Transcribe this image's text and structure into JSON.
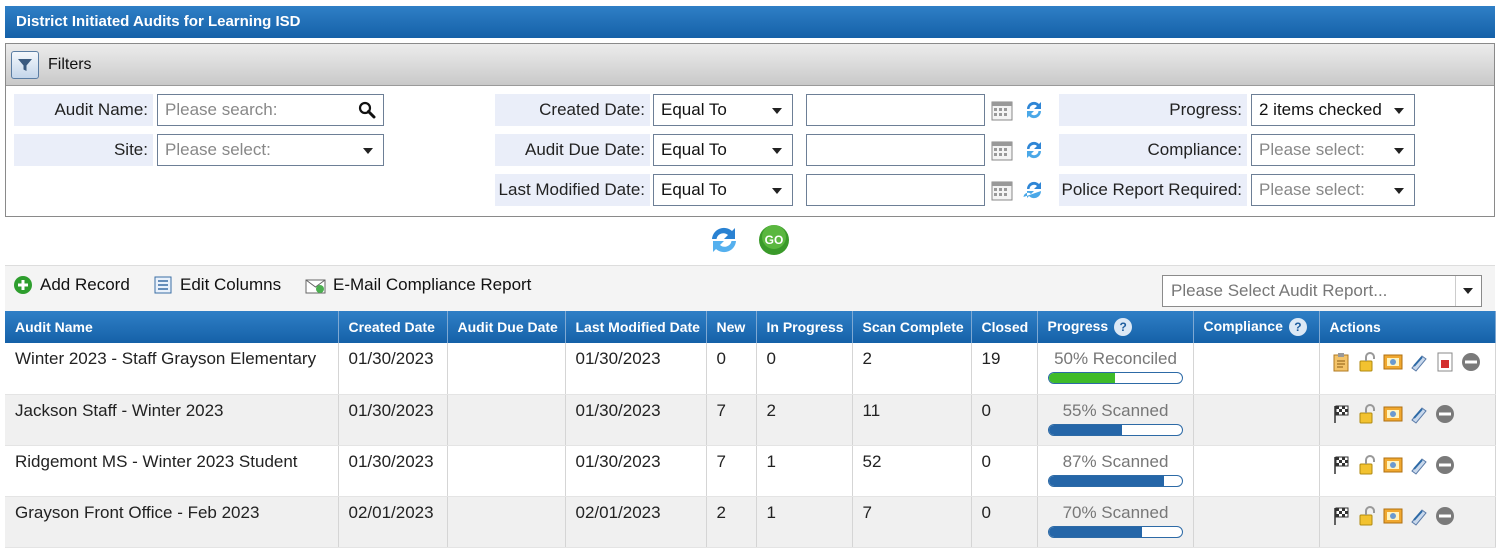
{
  "title": "District Initiated Audits for Learning ISD",
  "filters": {
    "header_label": "Filters",
    "audit_name": {
      "label": "Audit Name:",
      "placeholder": "Please search:"
    },
    "site": {
      "label": "Site:",
      "placeholder": "Please select:"
    },
    "created_date": {
      "label": "Created Date:",
      "operator": "Equal To",
      "value": ""
    },
    "audit_due_date": {
      "label": "Audit Due Date:",
      "operator": "Equal To",
      "value": ""
    },
    "last_modified_date": {
      "label": "Last Modified Date:",
      "operator": "Equal To",
      "value": ""
    },
    "progress": {
      "label": "Progress:",
      "value": "2 items checked"
    },
    "compliance": {
      "label": "Compliance:",
      "placeholder": "Please select:"
    },
    "police_report": {
      "label": "Police Report Required:",
      "placeholder": "Please select:"
    }
  },
  "toolbar": {
    "add_record": "Add Record",
    "edit_columns": "Edit Columns",
    "email_report": "E-Mail Compliance Report",
    "audit_report_placeholder": "Please Select Audit Report..."
  },
  "columns": [
    "Audit Name",
    "Created Date",
    "Audit Due Date",
    "Last Modified Date",
    "New",
    "In Progress",
    "Scan Complete",
    "Closed",
    "Progress",
    "Compliance",
    "Actions"
  ],
  "rows": [
    {
      "name": "Winter 2023 - Staff Grayson Elementary",
      "created": "01/30/2023",
      "due": "",
      "modified": "01/30/2023",
      "new": "0",
      "in_progress": "0",
      "scan_complete": "2",
      "closed": "19",
      "progress_label": "50% Reconciled",
      "progress_pct": 50,
      "progress_color": "#3fbb2a",
      "compliance": "",
      "actions": [
        "clipboard-icon",
        "unlock-icon",
        "photo-icon",
        "scanner-icon",
        "pdf-report-icon",
        "remove-icon"
      ]
    },
    {
      "name": "Jackson Staff - Winter 2023",
      "created": "01/30/2023",
      "due": "",
      "modified": "01/30/2023",
      "new": "7",
      "in_progress": "2",
      "scan_complete": "11",
      "closed": "0",
      "progress_label": "55% Scanned",
      "progress_pct": 55,
      "progress_color": "#2566a8",
      "compliance": "",
      "actions": [
        "checkered-flag-icon",
        "unlock-icon",
        "photo-icon",
        "scanner-icon",
        "remove-icon"
      ]
    },
    {
      "name": "Ridgemont MS - Winter 2023 Student",
      "created": "01/30/2023",
      "due": "",
      "modified": "01/30/2023",
      "new": "7",
      "in_progress": "1",
      "scan_complete": "52",
      "closed": "0",
      "progress_label": "87% Scanned",
      "progress_pct": 87,
      "progress_color": "#2566a8",
      "compliance": "",
      "actions": [
        "checkered-flag-icon",
        "unlock-icon",
        "photo-icon",
        "scanner-icon",
        "remove-icon"
      ]
    },
    {
      "name": "Grayson Front Office - Feb 2023",
      "created": "02/01/2023",
      "due": "",
      "modified": "02/01/2023",
      "new": "2",
      "in_progress": "1",
      "scan_complete": "7",
      "closed": "0",
      "progress_label": "70% Scanned",
      "progress_pct": 70,
      "progress_color": "#2566a8",
      "compliance": "",
      "actions": [
        "checkered-flag-icon",
        "unlock-icon",
        "photo-icon",
        "scanner-icon",
        "remove-icon"
      ]
    }
  ],
  "colors": {
    "header_blue": "#1561a8",
    "label_bg": "#eaeef9",
    "go_green": "#3a9a2a"
  }
}
